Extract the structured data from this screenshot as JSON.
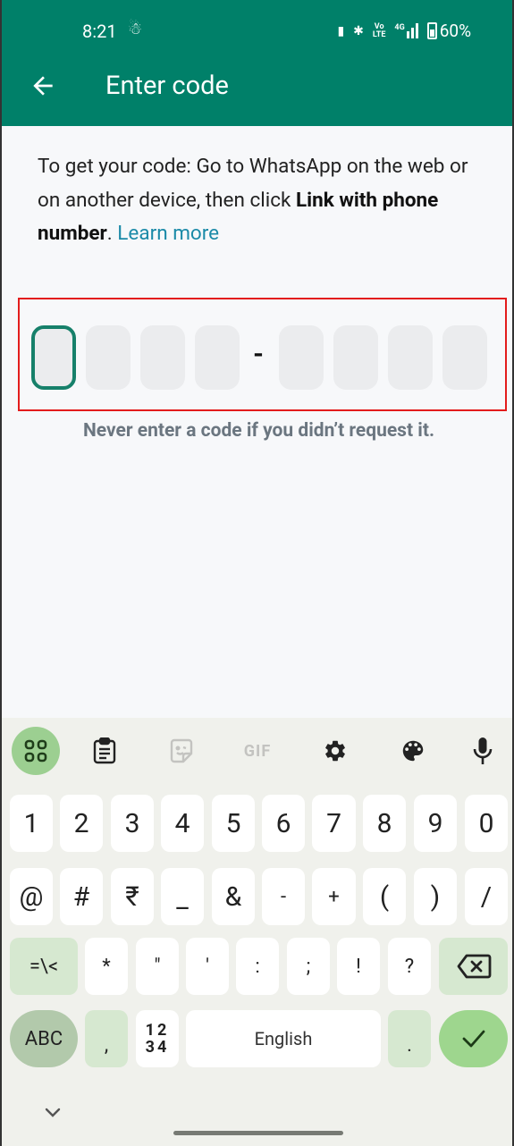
{
  "status_bar": {
    "time": "8:21",
    "battery": "60%",
    "network": "4G",
    "volte": "Vo LTE",
    "icons": [
      "snapchat-icon",
      "vibrate-icon",
      "bluetooth-icon",
      "volte-icon",
      "signal-icon",
      "battery-icon"
    ]
  },
  "header": {
    "title": "Enter code",
    "back_icon": "arrow-left-icon"
  },
  "description": {
    "text_before": "To get your code: Go to WhatsApp on the web or on another device, then click ",
    "bold": "Link with phone number",
    "text_after": ". ",
    "link": "Learn more"
  },
  "code_input": {
    "cells": [
      "",
      "",
      "",
      "",
      "",
      "",
      "",
      ""
    ],
    "separator": "-",
    "active_index": 0
  },
  "warning": "Never enter a code if you didn’t request it.",
  "keyboard": {
    "toolbar": [
      "apps-grid-icon",
      "clipboard-icon",
      "sticker-icon",
      "GIF",
      "gear-icon",
      "palette-icon",
      "microphone-icon"
    ],
    "row1": [
      "1",
      "2",
      "3",
      "4",
      "5",
      "6",
      "7",
      "8",
      "9",
      "0"
    ],
    "row2": [
      "@",
      "#",
      "₹",
      "_",
      "&",
      "-",
      "+",
      "(",
      ")",
      "/"
    ],
    "row3": [
      "=\\<",
      "*",
      "\"",
      "'",
      ":",
      ";",
      "!",
      "?"
    ],
    "row4": {
      "abc": "ABC",
      "comma": ",",
      "numpad_top": "12",
      "numpad_bottom": "34",
      "space": "English",
      "period": "."
    }
  },
  "colors": {
    "brand": "#008069",
    "link": "#1b8aa8",
    "active_cell": "#16806a",
    "highlight_frame": "#e31c1c"
  }
}
